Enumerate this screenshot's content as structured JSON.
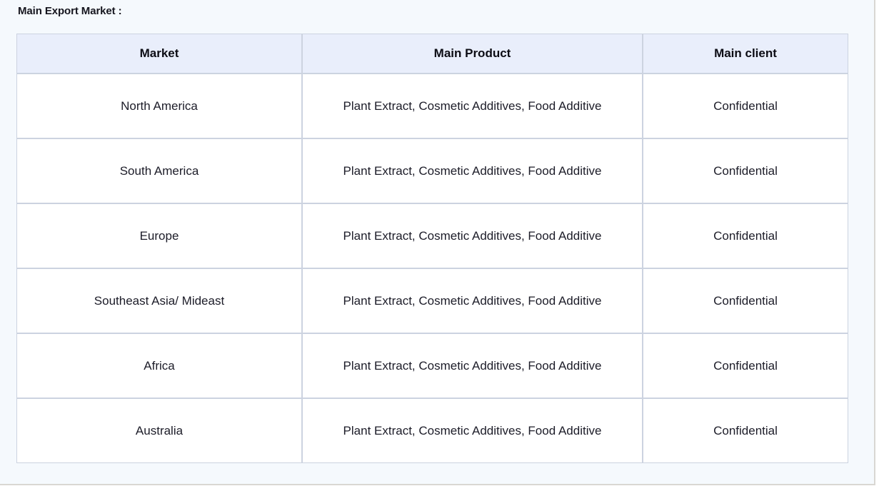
{
  "panel": {
    "background_color": "#f5f9fd",
    "border_color": "#d9d7d3"
  },
  "section": {
    "title": "Main Export Market :"
  },
  "table": {
    "header_background_color": "#e9eefb",
    "border_color": "#ccd3e0",
    "columns": [
      {
        "key": "market",
        "label": "Market"
      },
      {
        "key": "product",
        "label": "Main Product"
      },
      {
        "key": "client",
        "label": "Main client"
      }
    ],
    "rows": [
      {
        "market": "North America",
        "product": "Plant Extract, Cosmetic Additives, Food Additive",
        "client": "Confidential"
      },
      {
        "market": "South America",
        "product": "Plant Extract, Cosmetic Additives, Food Additive",
        "client": "Confidential"
      },
      {
        "market": "Europe",
        "product": "Plant Extract, Cosmetic Additives, Food Additive",
        "client": "Confidential"
      },
      {
        "market": "Southeast Asia/ Mideast",
        "product": "Plant Extract, Cosmetic Additives, Food Additive",
        "client": "Confidential"
      },
      {
        "market": "Africa",
        "product": "Plant Extract, Cosmetic Additives, Food Additive",
        "client": "Confidential"
      },
      {
        "market": "Australia",
        "product": "Plant Extract, Cosmetic Additives, Food Additive",
        "client": "Confidential"
      }
    ]
  }
}
